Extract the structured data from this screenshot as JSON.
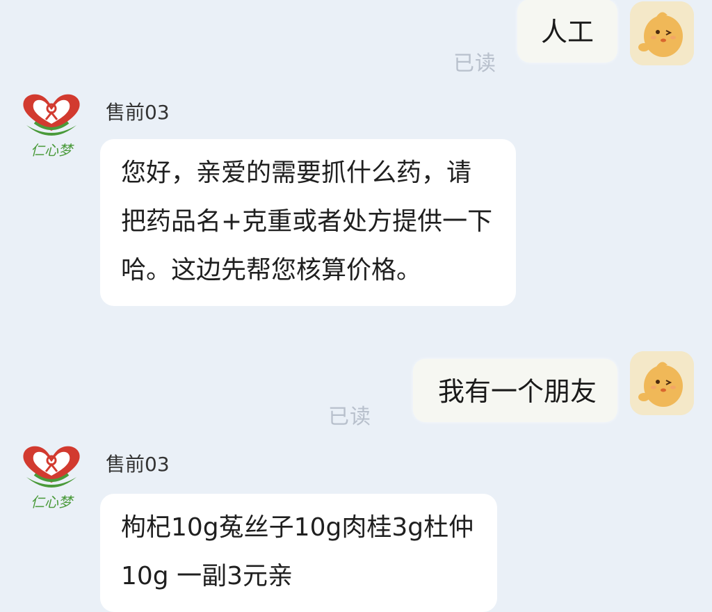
{
  "chat": {
    "messages": [
      {
        "side": "out",
        "text": "人工",
        "read": "已读"
      },
      {
        "side": "in",
        "sender": "售前03",
        "lines": [
          "您好，亲爱的需要抓什么药，请",
          "把药品名+克重或者处方提供一下",
          "哈。这边先帮您核算价格。"
        ]
      },
      {
        "side": "out",
        "text": "我有一个朋友",
        "read": "已读"
      },
      {
        "side": "in",
        "sender": "售前03",
        "lines": [
          "枸杞10g菟丝子10g肉桂3g杜仲",
          "10g 一副3元亲"
        ]
      }
    ],
    "shop_logo_text": "仁心梦",
    "self_avatar_icon": "cartoon-chick-waving-icon",
    "shop_avatar_icon": "heart-logo-icon"
  },
  "colors": {
    "background": "#eaf0f7",
    "bubble_in": "#ffffff",
    "bubble_out": "#f6f7f2",
    "read_receipt": "#b8c0cc",
    "logo_red": "#d23a2f",
    "logo_green": "#4a9a3a"
  }
}
